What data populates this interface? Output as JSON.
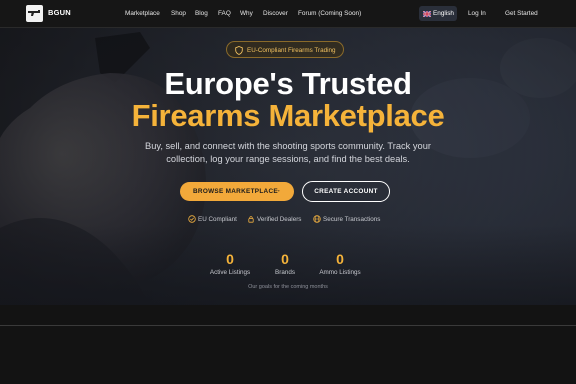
{
  "nav": {
    "brand": "BGUN",
    "links": [
      "Marketplace",
      "Shop",
      "Blog",
      "FAQ",
      "Why",
      "Discover",
      "Forum (Coming Soon)"
    ],
    "language": "English",
    "login": "Log In",
    "get_started": "Get Started"
  },
  "hero": {
    "badge": "EU-Compliant Firearms Trading",
    "title_line1": "Europe's Trusted",
    "title_line2": "Firearms Marketplace",
    "subtitle": "Buy, sell, and connect with the shooting sports community. Track your collection, log your range sessions, and find the best deals.",
    "primary_button": "BROWSE MARKETPLACE",
    "secondary_button": "CREATE ACCOUNT",
    "trust": [
      "EU Compliant",
      "Verified Dealers",
      "Secure Transactions"
    ],
    "stats": [
      {
        "value": "0",
        "label": "Active Listings"
      },
      {
        "value": "0",
        "label": "Brands"
      },
      {
        "value": "0",
        "label": "Ammo Listings"
      }
    ],
    "goals_note": "Our goals for the coming months"
  },
  "colors": {
    "accent": "#f5b33a",
    "background": "#131313",
    "nav_background": "#161616"
  }
}
